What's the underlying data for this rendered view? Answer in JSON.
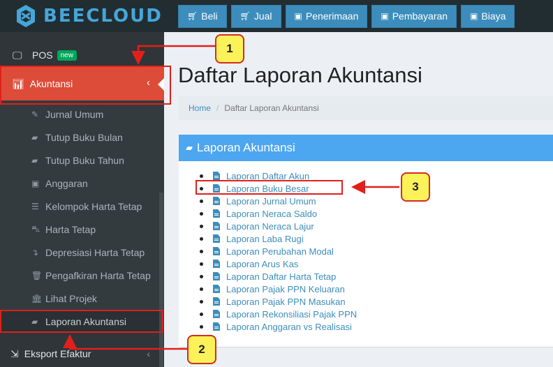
{
  "app": {
    "logo_text": "BEECLOUD",
    "brand_color": "#45a6d9"
  },
  "topnav": [
    {
      "label": "Beli",
      "icon": "cart-icon"
    },
    {
      "label": "Jual",
      "icon": "cart-icon"
    },
    {
      "label": "Penerimaan",
      "icon": "money-icon"
    },
    {
      "label": "Pembayaran",
      "icon": "money-icon"
    },
    {
      "label": "Biaya",
      "icon": "money-icon"
    }
  ],
  "sidebar": {
    "pos": {
      "label": "POS",
      "badge": "new"
    },
    "akuntansi": {
      "label": "Akuntansi"
    },
    "submenu": [
      "Jurnal Umum",
      "Tutup Buku Bulan",
      "Tutup Buku Tahun",
      "Anggaran",
      "Kelompok Harta Tetap",
      "Harta Tetap",
      "Depresiasi Harta Tetap",
      "Pengafkiran Harta Tetap",
      "Lihat Projek",
      "Laporan Akuntansi"
    ],
    "eksport": {
      "label": "Eksport Efaktur"
    }
  },
  "main": {
    "title": "Daftar Laporan Akuntansi",
    "breadcrumb": {
      "home": "Home",
      "current": "Daftar Laporan Akuntansi"
    },
    "box_title": "Laporan Akuntansi",
    "reports": [
      "Laporan Daftar Akun",
      "Laporan Buku Besar",
      "Laporan Jurnal Umum",
      "Laporan Neraca Saldo",
      "Laporan Neraca Lajur",
      "Laporan Laba Rugi",
      "Laporan Perubahan Modal",
      "Laporan Arus Kas",
      "Laporan Daftar Harta Tetap",
      "Laporan Pajak PPN Keluaran",
      "Laporan Pajak PPN Masukan",
      "Laporan Rekonsiliasi Pajak PPN",
      "Laporan Anggaran vs Realisasi"
    ]
  },
  "callouts": {
    "one": "1",
    "two": "2",
    "three": "3"
  }
}
